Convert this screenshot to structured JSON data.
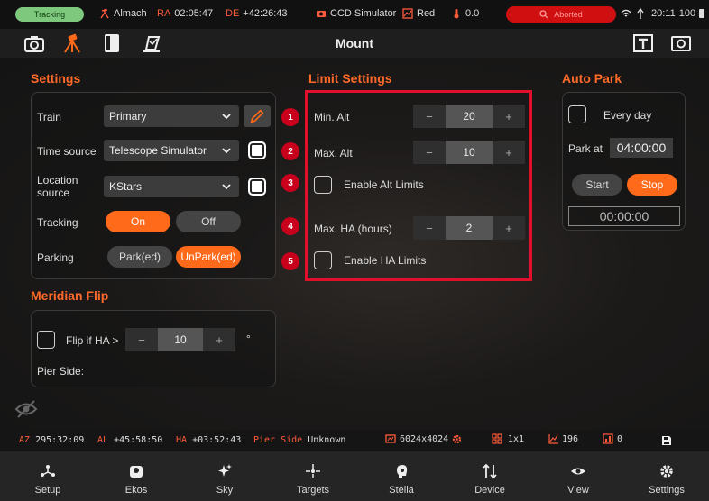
{
  "statusbar": {
    "tracking": "Tracking",
    "mount_name": "Almach",
    "ra_key": "RA",
    "ra_value": "02:05:47",
    "de_key": "DE",
    "de_value": "+42:26:43",
    "camera": "CCD Simulator",
    "filter": "Red",
    "temp": "0.0",
    "alarm": "Aborted",
    "time": "20:11",
    "battery": "100"
  },
  "toolbar": {
    "title": "Mount"
  },
  "settings": {
    "title": "Settings",
    "train_label": "Train",
    "train_value": "Primary",
    "time_source_label": "Time source",
    "time_source_value": "Telescope Simulator",
    "location_label": "Location source",
    "location_value": "KStars",
    "tracking_label": "Tracking",
    "tracking_on": "On",
    "tracking_off": "Off",
    "parking_label": "Parking",
    "park_label": "Park(ed)",
    "unpark_label": "UnPark(ed)"
  },
  "limits": {
    "title": "Limit Settings",
    "min_alt_label": "Min. Alt",
    "min_alt_value": "20",
    "max_alt_label": "Max. Alt",
    "max_alt_value": "10",
    "enable_alt_label": "Enable Alt Limits",
    "max_ha_label": "Max. HA (hours)",
    "max_ha_value": "2",
    "enable_ha_label": "Enable HA Limits",
    "markers": [
      "1",
      "2",
      "3",
      "4",
      "5"
    ],
    "minus": "−",
    "plus": "+"
  },
  "autopark": {
    "title": "Auto Park",
    "every_day_label": "Every day",
    "park_at_label": "Park at",
    "park_at_value": "04:00:00",
    "start_label": "Start",
    "stop_label": "Stop",
    "countdown": "00:00:00"
  },
  "meridian": {
    "title": "Meridian Flip",
    "flip_label": "Flip if HA >",
    "flip_value": "10",
    "degree": "°",
    "pier_side_label": "Pier Side:"
  },
  "statusline": {
    "az_key": "AZ",
    "az_value": "295:32:09",
    "al_key": "AL",
    "al_value": "+45:58:50",
    "ha_key": "HA",
    "ha_value": "+03:52:43",
    "pier_key": "Pier Side",
    "pier_value": "Unknown",
    "resolution": "6024x4024",
    "binning": "1x1",
    "hfr_count": "196",
    "zero_count": "0"
  },
  "nav": {
    "items": [
      "Setup",
      "Ekos",
      "Sky",
      "Targets",
      "Stella",
      "Device",
      "View",
      "Settings"
    ]
  },
  "colors": {
    "accent": "#ff6a1a",
    "highlight": "#e0102a",
    "tracking_pill": "#7ec87e",
    "alarm": "#d01010"
  }
}
